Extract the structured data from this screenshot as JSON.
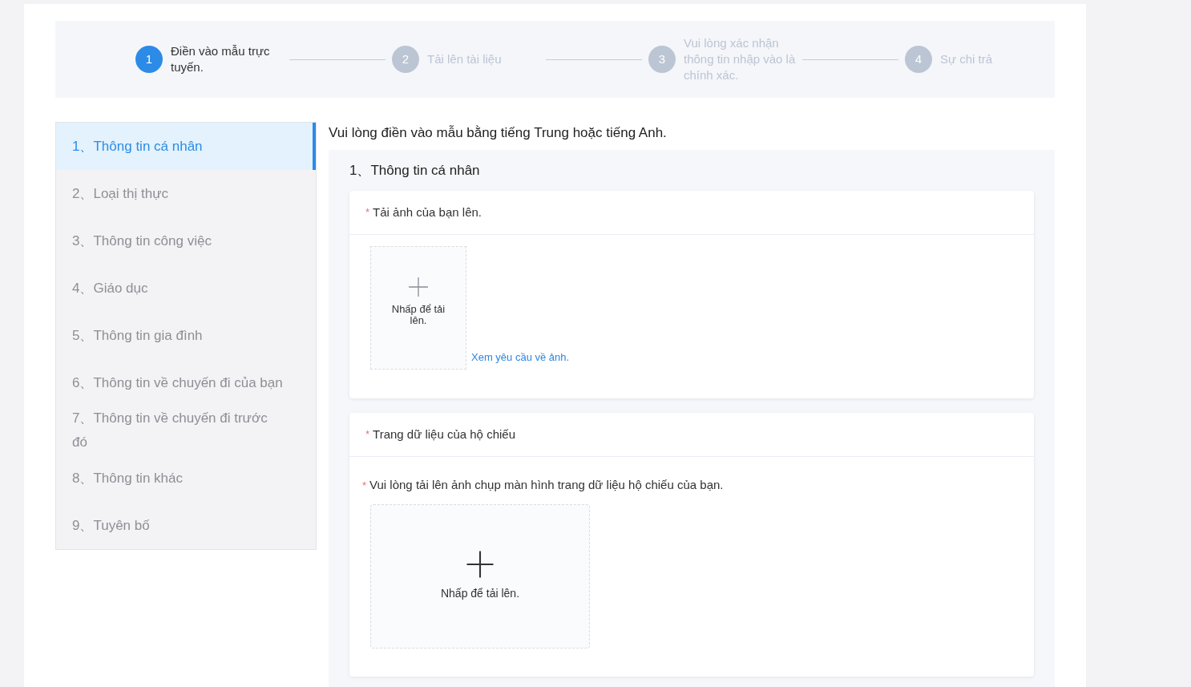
{
  "steps": [
    {
      "number": "1",
      "label": "Điền vào mẫu trực tuyến.",
      "selected": true
    },
    {
      "number": "2",
      "label": "Tải lên tài liệu",
      "selected": false
    },
    {
      "number": "3",
      "label": "Vui lòng xác nhận thông tin nhập vào là chính xác.",
      "selected": false
    },
    {
      "number": "4",
      "label": "Sự chi trả",
      "selected": false
    }
  ],
  "sidebar": {
    "items": [
      {
        "label": "1、Thông tin cá nhân",
        "selected": true
      },
      {
        "label": "2、Loại thị thực",
        "selected": false
      },
      {
        "label": "3、Thông tin công việc",
        "selected": false
      },
      {
        "label": "4、Giáo dục",
        "selected": false
      },
      {
        "label": "5、Thông tin gia đình",
        "selected": false
      },
      {
        "label": "6、Thông tin về chuyến đi của bạn",
        "selected": false
      },
      {
        "label": "7、Thông tin về chuyến đi trước đó",
        "selected": false
      },
      {
        "label": "8、Thông tin khác",
        "selected": false
      },
      {
        "label": "9、Tuyên bố",
        "selected": false
      }
    ]
  },
  "intro": "Vui lòng điền vào mẫu bằng tiếng Trung hoặc tiếng Anh.",
  "section": {
    "title": "1、Thông tin cá nhân",
    "cards": [
      {
        "kind": "photo",
        "required_mark": "*",
        "title": "Tải ảnh của bạn lên.",
        "upload_label": "Nhấp để tải lên.",
        "link": "Xem yêu cầu về ảnh."
      },
      {
        "kind": "passport",
        "required_mark": "*",
        "title": "Trang dữ liệu của hộ chiếu",
        "field_required_mark": "*",
        "field_label": "Vui lòng tải lên ảnh chụp màn hình trang dữ liệu hộ chiếu của bạn.",
        "upload_label": "Nhấp để tải lên."
      }
    ]
  }
}
